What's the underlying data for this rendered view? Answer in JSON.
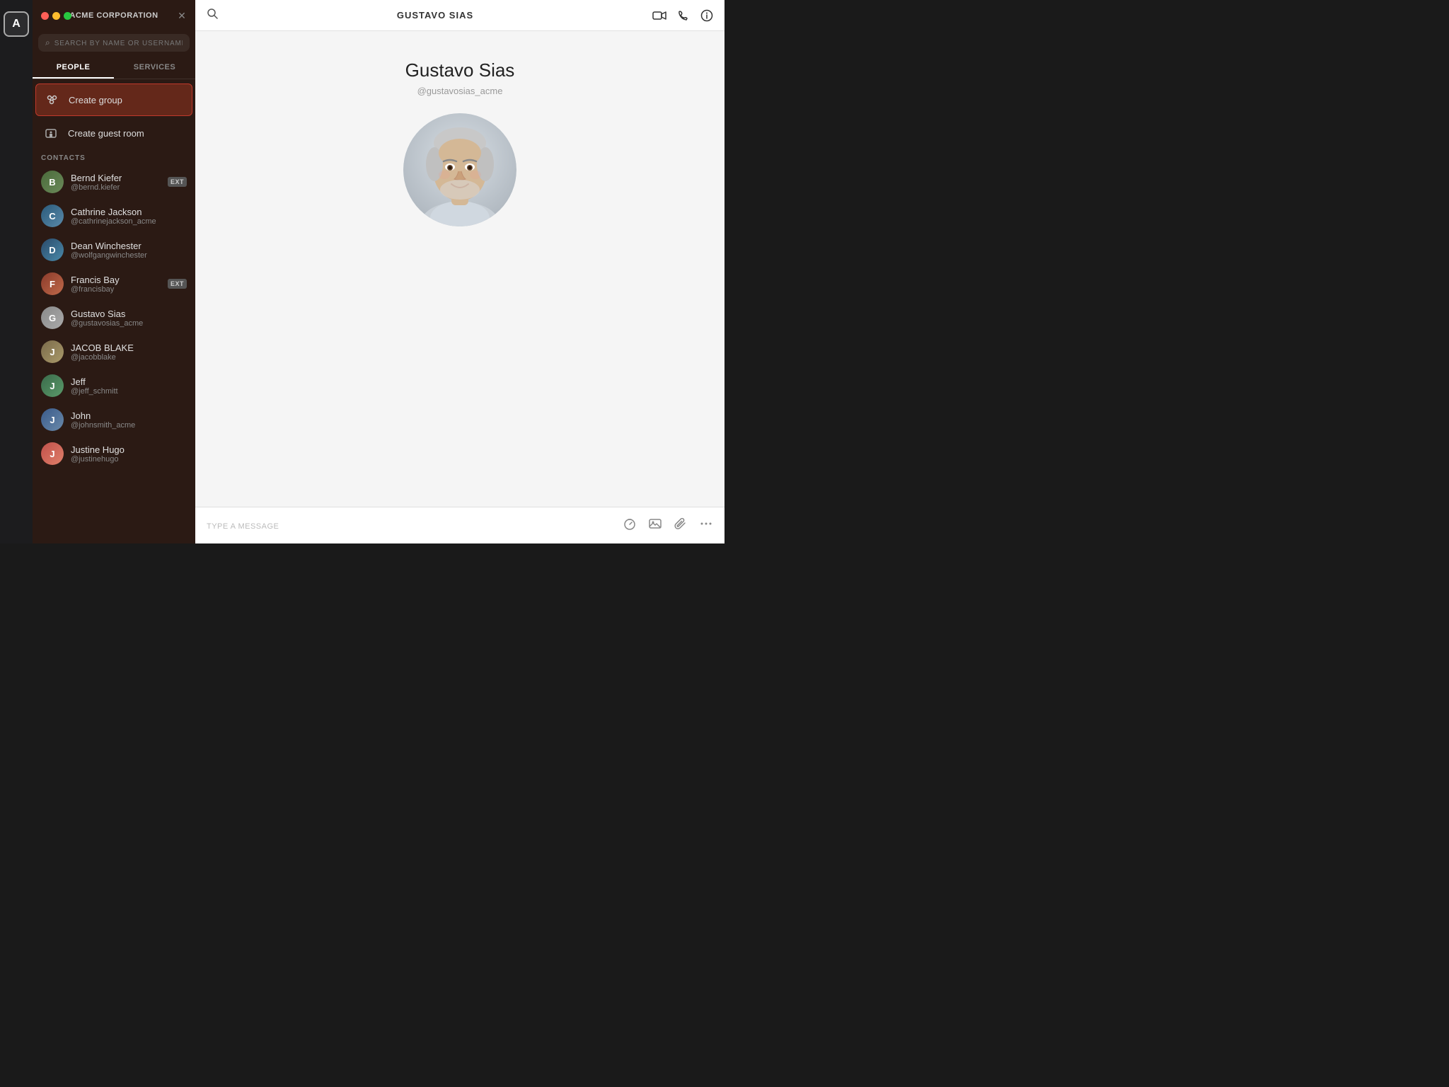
{
  "app": {
    "title": "ACME CORPORATION",
    "traffic_lights": [
      "red",
      "yellow",
      "green"
    ]
  },
  "sidebar_left": {
    "avatar_label": "A"
  },
  "middle_panel": {
    "search_placeholder": "SEARCH BY NAME OR USERNAME",
    "tabs": [
      {
        "id": "people",
        "label": "PEOPLE",
        "active": true
      },
      {
        "id": "services",
        "label": "SERVICES",
        "active": false
      }
    ],
    "create_group": {
      "label": "Create group",
      "icon": "✦"
    },
    "create_guest_room": {
      "label": "Create guest room",
      "icon": "🎫"
    },
    "contacts_section_label": "CONTACTS",
    "contacts": [
      {
        "name": "Bernd Kiefer",
        "handle": "@bernd.kiefer",
        "ext": true,
        "avatar_class": "av-bernd"
      },
      {
        "name": "Cathrine Jackson",
        "handle": "@cathrinejackson_acme",
        "ext": false,
        "avatar_class": "av-cathrine"
      },
      {
        "name": "Dean Winchester",
        "handle": "@wolfgangwinchester",
        "ext": false,
        "avatar_class": "av-dean"
      },
      {
        "name": "Francis Bay",
        "handle": "@francisbay",
        "ext": true,
        "avatar_class": "av-francis"
      },
      {
        "name": "Gustavo Sias",
        "handle": "@gustavosias_acme",
        "ext": false,
        "avatar_class": "av-gustavo"
      },
      {
        "name": "JACOB BLAKE",
        "handle": "@jacobblake",
        "ext": false,
        "avatar_class": "av-jacob"
      },
      {
        "name": "Jeff",
        "handle": "@jeff_schmitt",
        "ext": false,
        "avatar_class": "av-jeff"
      },
      {
        "name": "John",
        "handle": "@johnsmith_acme",
        "ext": false,
        "avatar_class": "av-john"
      },
      {
        "name": "Justine Hugo",
        "handle": "@justinehugo",
        "ext": false,
        "avatar_class": "av-justine"
      }
    ],
    "ext_label": "EXT"
  },
  "main_panel": {
    "header_title": "GUSTAVO SIAS",
    "profile_name": "Gustavo Sias",
    "profile_handle": "@gustavosias_acme",
    "message_placeholder": "TYPE A MESSAGE",
    "toolbar": {
      "search_icon": "search",
      "video_icon": "video",
      "phone_icon": "phone",
      "info_icon": "info",
      "timer_icon": "timer",
      "image_icon": "image",
      "attach_icon": "attach",
      "more_icon": "more"
    }
  }
}
